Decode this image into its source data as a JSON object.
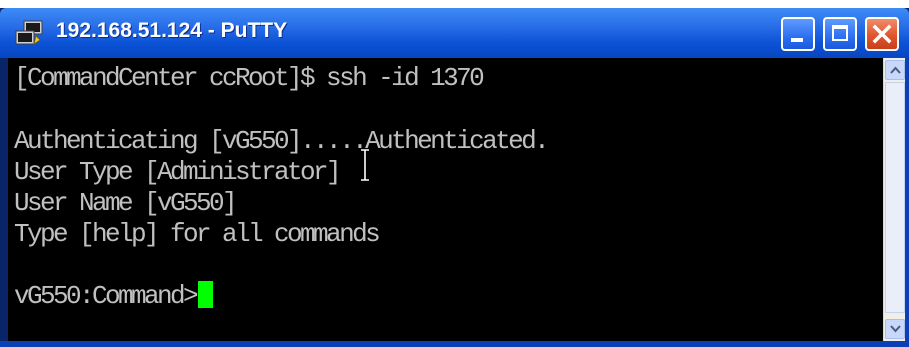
{
  "window": {
    "title": "192.168.51.124 - PuTTY",
    "icon": "putty-icon",
    "controls": [
      "minimize-icon",
      "maximize-icon",
      "close-icon"
    ]
  },
  "terminal": {
    "lines": [
      "[CommandCenter ccRoot]$ ssh -id 1370",
      "",
      "Authenticating [vG550].....Authenticated.",
      "User Type [Administrator]",
      "User Name [vG550]",
      "Type [help] for all commands",
      "",
      "vG550:Command>"
    ],
    "text_color": "#c0c0c0",
    "background": "#000000",
    "cursor_color": "#00ff00"
  },
  "colors": {
    "titlebar": "#0b52d6",
    "close_button": "#e0552c"
  }
}
